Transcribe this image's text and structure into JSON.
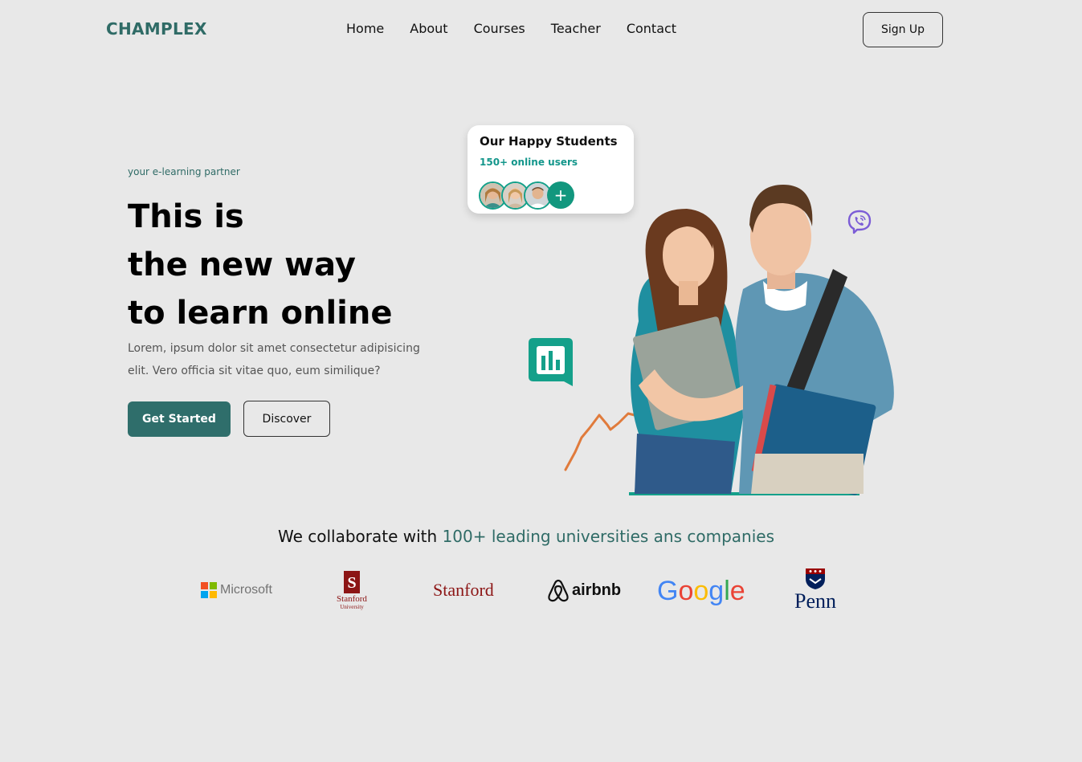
{
  "brand": "CHAMPLEX",
  "nav": {
    "items": [
      {
        "label": "Home"
      },
      {
        "label": "About"
      },
      {
        "label": "Courses"
      },
      {
        "label": "Teacher"
      },
      {
        "label": "Contact"
      }
    ],
    "signup_label": "Sign Up"
  },
  "hero": {
    "tagline": "your e-learning partner",
    "title_lines": [
      "This is",
      "the new way",
      "to learn online"
    ],
    "description": "Lorem, ipsum dolor sit amet consectetur adipisicing elit. Vero officia sit vitae quo, eum similique?",
    "primary_label": "Get Started",
    "secondary_label": "Discover"
  },
  "students_card": {
    "title": "Our Happy Students",
    "subtitle": "150+ online users",
    "plus": "+"
  },
  "collab": {
    "prefix": "We collaborate with",
    "highlight": "100+ leading universities ans companies"
  },
  "partners": [
    {
      "name": "Microsoft"
    },
    {
      "name": "Stanford",
      "sub": "University"
    },
    {
      "name": "Stanford"
    },
    {
      "name": "airbnb"
    },
    {
      "name": "Google"
    },
    {
      "name": "Penn"
    }
  ],
  "colors": {
    "background": "#e8e8e8",
    "brand": "#2f6b66",
    "primary_button": "#2f6e6b",
    "accent_green": "#13968b",
    "viber": "#7b5cd6",
    "squiggle": "#e07b3c"
  },
  "icons": [
    "chart-icon",
    "viber-icon",
    "plus-icon"
  ]
}
